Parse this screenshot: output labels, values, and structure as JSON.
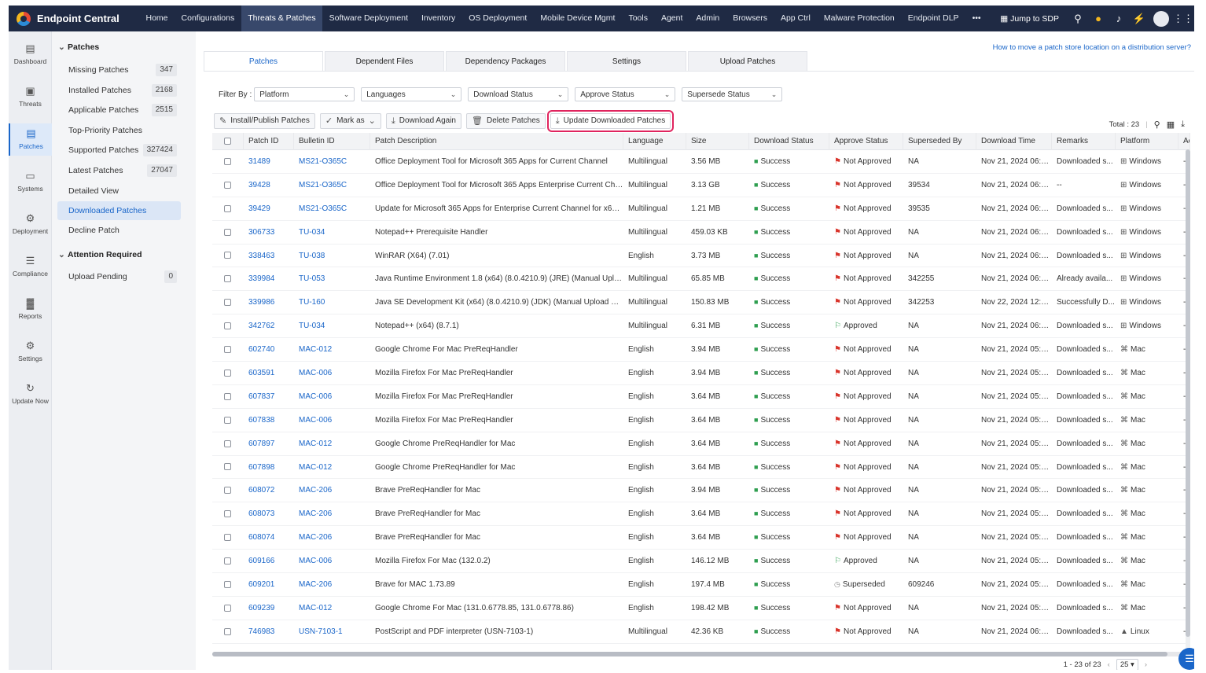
{
  "app": {
    "name": "Endpoint Central"
  },
  "topnav": {
    "items": [
      "Home",
      "Configurations",
      "Threats & Patches",
      "Software Deployment",
      "Inventory",
      "OS Deployment",
      "Mobile Device Mgmt",
      "Tools",
      "Agent",
      "Admin",
      "Browsers",
      "App Ctrl",
      "Malware Protection",
      "Endpoint DLP",
      "•••"
    ],
    "active_index": 2,
    "jump": "Jump to SDP"
  },
  "rail": [
    {
      "label": "Dashboard",
      "icon": "dashboard-icon",
      "glyph": "▤"
    },
    {
      "label": "Threats",
      "icon": "threats-icon",
      "glyph": "▣"
    },
    {
      "label": "Patches",
      "icon": "patches-icon",
      "glyph": "▤"
    },
    {
      "label": "Systems",
      "icon": "systems-icon",
      "glyph": "▭"
    },
    {
      "label": "Deployment",
      "icon": "deployment-icon",
      "glyph": "⚙"
    },
    {
      "label": "Compliance",
      "icon": "compliance-icon",
      "glyph": "☰"
    },
    {
      "label": "Reports",
      "icon": "reports-icon",
      "glyph": "▓"
    },
    {
      "label": "Settings",
      "icon": "settings-icon",
      "glyph": "⚙"
    },
    {
      "label": "Update Now",
      "icon": "update-icon",
      "glyph": "↻"
    }
  ],
  "sidebar": {
    "patches_heading": "Patches",
    "items": [
      {
        "label": "Missing Patches",
        "count": "347"
      },
      {
        "label": "Installed Patches",
        "count": "2168"
      },
      {
        "label": "Applicable Patches",
        "count": "2515"
      },
      {
        "label": "Top-Priority Patches",
        "count": ""
      },
      {
        "label": "Supported Patches",
        "count": "327424"
      },
      {
        "label": "Latest Patches",
        "count": "27047"
      },
      {
        "label": "Detailed View",
        "count": ""
      },
      {
        "label": "Downloaded Patches",
        "count": ""
      },
      {
        "label": "Decline Patch",
        "count": ""
      }
    ],
    "attention_heading": "Attention Required",
    "attention_items": [
      {
        "label": "Upload Pending",
        "count": "0"
      }
    ]
  },
  "help_link": "How to move a patch store location on a distribution server?",
  "tabs": [
    "Patches",
    "Dependent Files",
    "Dependency Packages",
    "Settings",
    "Upload Patches"
  ],
  "filters": {
    "label": "Filter By :",
    "selects": [
      "Platform",
      "Languages",
      "Download Status",
      "Approve Status",
      "Supersede Status"
    ]
  },
  "actions": {
    "install": "Install/Publish Patches",
    "markas": "Mark as",
    "download_again": "Download Again",
    "delete": "Delete Patches",
    "update": "Update Downloaded Patches"
  },
  "total": "Total : 23",
  "table": {
    "columns": [
      "Patch ID",
      "Bulletin ID",
      "Patch Description",
      "Language",
      "Size",
      "Download Status",
      "Approve Status",
      "Superseded By",
      "Download Time",
      "Remarks",
      "Platform",
      "Ac"
    ],
    "rows": [
      [
        "31489",
        "MS21-O365C",
        "Office Deployment Tool for Microsoft 365 Apps for Current Channel",
        "Multilingual",
        "3.56 MB",
        "Success",
        "Not Approved",
        "NA",
        "Nov 21, 2024 06:1...",
        "Downloaded s...",
        "Windows"
      ],
      [
        "39428",
        "MS21-O365C",
        "Office Deployment Tool for Microsoft 365 Apps Enterprise Current Chann...",
        "Multilingual",
        "3.13 GB",
        "Success",
        "Not Approved",
        "39534",
        "Nov 21, 2024 06:2...",
        "--",
        "Windows"
      ],
      [
        "39429",
        "MS21-O365C",
        "Update for Microsoft 365 Apps for Enterprise Current Channel for x64 24...",
        "Multilingual",
        "1.21 MB",
        "Success",
        "Not Approved",
        "39535",
        "Nov 21, 2024 06:1...",
        "Downloaded s...",
        "Windows"
      ],
      [
        "306733",
        "TU-034",
        "Notepad++ Prerequisite Handler",
        "Multilingual",
        "459.03 KB",
        "Success",
        "Not Approved",
        "NA",
        "Nov 21, 2024 06:0...",
        "Downloaded s...",
        "Windows"
      ],
      [
        "338463",
        "TU-038",
        "WinRAR (X64) (7.01)",
        "English",
        "3.73 MB",
        "Success",
        "Not Approved",
        "NA",
        "Nov 21, 2024 06:2...",
        "Downloaded s...",
        "Windows"
      ],
      [
        "339984",
        "TU-053",
        "Java Runtime Environment 1.8 (x64) (8.0.4210.9) (JRE) (Manual Upload Re...",
        "Multilingual",
        "65.85 MB",
        "Success",
        "Not Approved",
        "342255",
        "Nov 21, 2024 06:2...",
        "Already availa...",
        "Windows"
      ],
      [
        "339986",
        "TU-160",
        "Java SE Development Kit (x64) (8.0.4210.9) (JDK) (Manual Upload Require...",
        "Multilingual",
        "150.83 MB",
        "Success",
        "Not Approved",
        "342253",
        "Nov 22, 2024 12:1...",
        "Successfully D...",
        "Windows"
      ],
      [
        "342762",
        "TU-034",
        "Notepad++ (x64) (8.7.1)",
        "Multilingual",
        "6.31 MB",
        "Success",
        "Approved",
        "NA",
        "Nov 21, 2024 06:0...",
        "Downloaded s...",
        "Windows"
      ],
      [
        "602740",
        "MAC-012",
        "Google Chrome For Mac PreReqHandler",
        "English",
        "3.94 MB",
        "Success",
        "Not Approved",
        "NA",
        "Nov 21, 2024 05:5...",
        "Downloaded s...",
        "Mac"
      ],
      [
        "603591",
        "MAC-006",
        "Mozilla Firefox For Mac PreReqHandler",
        "English",
        "3.94 MB",
        "Success",
        "Not Approved",
        "NA",
        "Nov 21, 2024 05:5...",
        "Downloaded s...",
        "Mac"
      ],
      [
        "607837",
        "MAC-006",
        "Mozilla Firefox For Mac PreReqHandler",
        "English",
        "3.64 MB",
        "Success",
        "Not Approved",
        "NA",
        "Nov 21, 2024 05:5...",
        "Downloaded s...",
        "Mac"
      ],
      [
        "607838",
        "MAC-006",
        "Mozilla Firefox For Mac PreReqHandler",
        "English",
        "3.64 MB",
        "Success",
        "Not Approved",
        "NA",
        "Nov 21, 2024 05:5...",
        "Downloaded s...",
        "Mac"
      ],
      [
        "607897",
        "MAC-012",
        "Google Chrome PreReqHandler for Mac",
        "English",
        "3.64 MB",
        "Success",
        "Not Approved",
        "NA",
        "Nov 21, 2024 05:5...",
        "Downloaded s...",
        "Mac"
      ],
      [
        "607898",
        "MAC-012",
        "Google Chrome PreReqHandler for Mac",
        "English",
        "3.64 MB",
        "Success",
        "Not Approved",
        "NA",
        "Nov 21, 2024 05:5...",
        "Downloaded s...",
        "Mac"
      ],
      [
        "608072",
        "MAC-206",
        "Brave PreReqHandler for Mac",
        "English",
        "3.94 MB",
        "Success",
        "Not Approved",
        "NA",
        "Nov 21, 2024 05:5...",
        "Downloaded s...",
        "Mac"
      ],
      [
        "608073",
        "MAC-206",
        "Brave PreReqHandler for Mac",
        "English",
        "3.64 MB",
        "Success",
        "Not Approved",
        "NA",
        "Nov 21, 2024 05:5...",
        "Downloaded s...",
        "Mac"
      ],
      [
        "608074",
        "MAC-206",
        "Brave PreReqHandler for Mac",
        "English",
        "3.64 MB",
        "Success",
        "Not Approved",
        "NA",
        "Nov 21, 2024 05:5...",
        "Downloaded s...",
        "Mac"
      ],
      [
        "609166",
        "MAC-006",
        "Mozilla Firefox For Mac (132.0.2)",
        "English",
        "146.12 MB",
        "Success",
        "Approved",
        "NA",
        "Nov 21, 2024 05:5...",
        "Downloaded s...",
        "Mac"
      ],
      [
        "609201",
        "MAC-206",
        "Brave for MAC 1.73.89",
        "English",
        "197.4 MB",
        "Success",
        "Superseded",
        "609246",
        "Nov 21, 2024 05:5...",
        "Downloaded s...",
        "Mac"
      ],
      [
        "609239",
        "MAC-012",
        "Google Chrome For Mac (131.0.6778.85, 131.0.6778.86)",
        "English",
        "198.42 MB",
        "Success",
        "Not Approved",
        "NA",
        "Nov 21, 2024 05:5...",
        "Downloaded s...",
        "Mac"
      ],
      [
        "746983",
        "USN-7103-1",
        "PostScript and PDF interpreter (USN-7103-1)",
        "Multilingual",
        "42.36 KB",
        "Success",
        "Not Approved",
        "NA",
        "Nov 21, 2024 06:1...",
        "Downloaded s...",
        "Linux"
      ]
    ],
    "trailing": "--"
  },
  "pager": {
    "range": "1 - 23 of 23",
    "size": "25 ▾"
  },
  "colors": {
    "topbar": "#1f2a44",
    "accent": "#1a66c9",
    "highlight": "#e0245e",
    "success": "#2e9e4f",
    "not_approved": "#d9342b"
  }
}
